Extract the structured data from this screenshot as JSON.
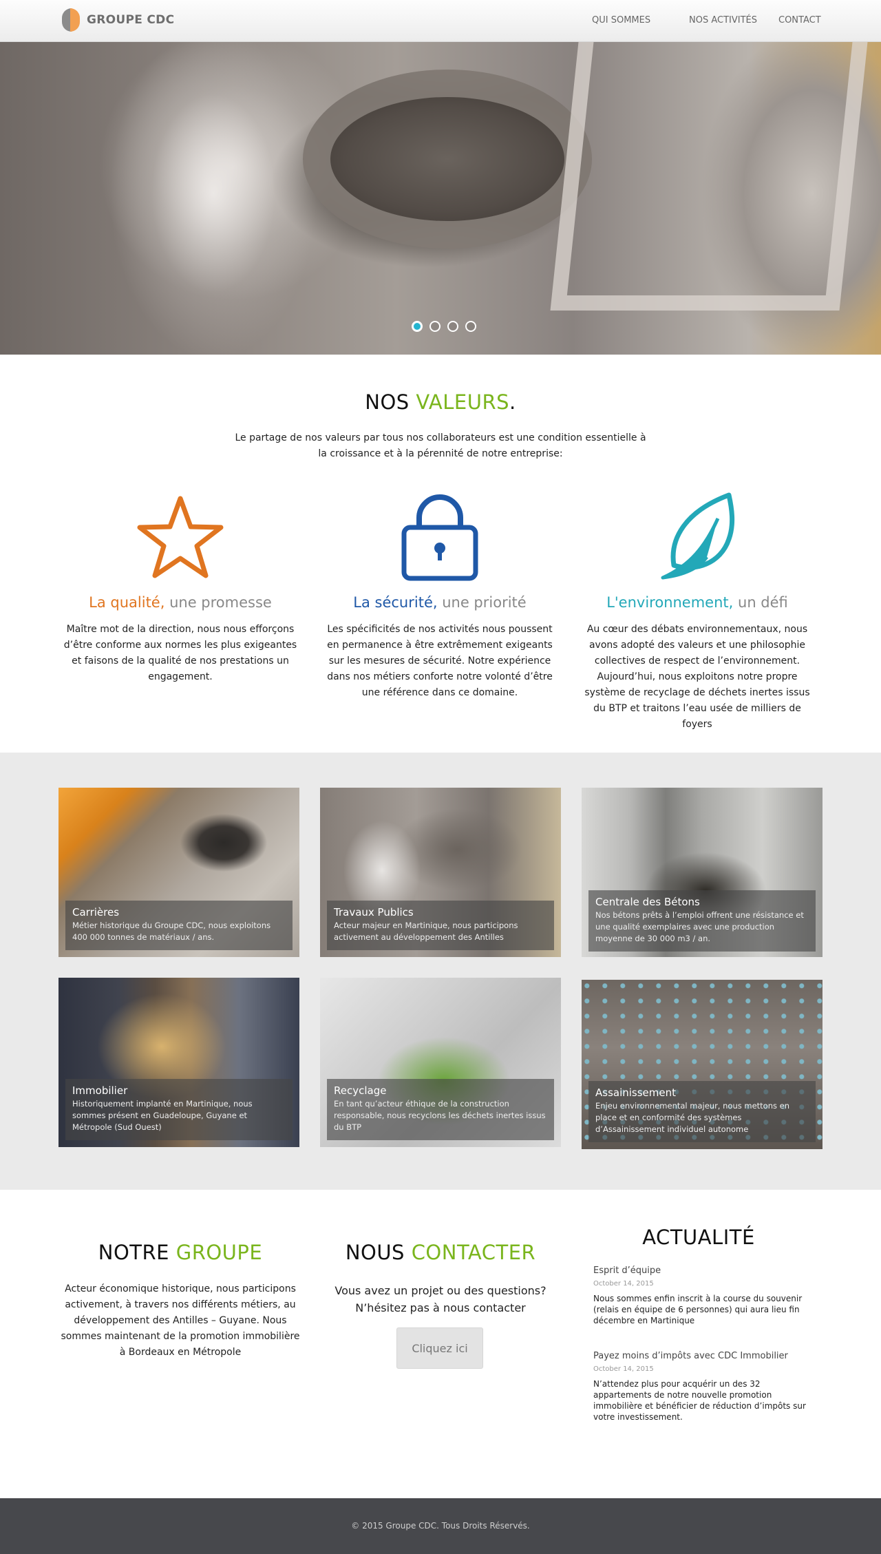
{
  "header": {
    "logo_text": "GROUPE CDC",
    "nav": [
      "QUI SOMMES",
      "NOS ACTIVITÉS",
      "CONTACT"
    ]
  },
  "hero": {
    "slides_count": 4,
    "active_slide": 1
  },
  "valeurs": {
    "title_main": "NOS ",
    "title_accent": "VALEURS",
    "title_end": ".",
    "intro": "Le partage de nos valeurs par tous nos collaborateurs est une condition essentielle à la croissance et à la pérennité de notre entreprise:",
    "items": [
      {
        "icon": "star-icon",
        "key": "La qualité,",
        "rest": " une promesse",
        "text": "Maître mot de la direction, nous nous efforçons d’être conforme aux normes les plus exigeantes et faisons de la qualité de nos prestations un engagement.",
        "color": "#e07520"
      },
      {
        "icon": "lock-icon",
        "key": "La sécurité,",
        "rest": " une priorité",
        "text": "Les spécificités de nos activités nous poussent en permanence à être extrêmement exigeants sur les mesures de sécurité. Notre expérience dans nos métiers conforte notre volonté d’être une référence dans ce domaine.",
        "color": "#1f58a7"
      },
      {
        "icon": "leaf-icon",
        "key": "L'environnement,",
        "rest": " un défi",
        "text": "Au cœur des débats environnementaux, nous avons adopté des valeurs et une philosophie collectives de respect de l’environnement. Aujourd’hui, nous exploitons notre propre système de recyclage de déchets inertes issus du BTP et traitons l’eau usée de milliers de foyers",
        "color": "#23a8b8"
      }
    ]
  },
  "activites": [
    {
      "title": "Carrières",
      "desc": "Métier historique du Groupe CDC, nous exploitons 400 000 tonnes de matériaux / ans."
    },
    {
      "title": "Travaux Publics",
      "desc": "Acteur majeur en Martinique, nous participons activement au développement des Antilles"
    },
    {
      "title": "Centrale des Bétons",
      "desc": "Nos bétons prêts à l’emploi offrent une résistance et une qualité exemplaires avec une production moyenne de 30 000 m3 / an."
    },
    {
      "title": "Immobilier",
      "desc": "Historiquement implanté en Martinique, nous sommes présent en Guadeloupe, Guyane et Métropole (Sud Ouest)"
    },
    {
      "title": "Recyclage",
      "desc": "En tant qu’acteur éthique de la construction responsable, nous recyclons les déchets inertes issus du BTP"
    },
    {
      "title": "Assainissement",
      "desc": "Enjeu environnemental majeur, nous mettons en place et en conformité des systèmes d’Assainissement individuel autonome"
    }
  ],
  "groupe": {
    "title_main": "NOTRE ",
    "title_accent": "GROUPE",
    "text": "Acteur économique historique, nous participons activement, à travers nos différents métiers, au développement des Antilles – Guyane. Nous sommes maintenant de la promotion immobilière à Bordeaux en Métropole"
  },
  "contact": {
    "title_main": "NOUS ",
    "title_accent": "CONTACTER",
    "line1": "Vous avez un projet ou des questions?",
    "line2": "N’hésitez pas à nous contacter",
    "button": "Cliquez ici"
  },
  "actualite": {
    "title": "ACTUALITÉ",
    "items": [
      {
        "title": "Esprit d’équipe",
        "date": "October 14, 2015",
        "text": "Nous sommes enfin inscrit à la course du souvenir (relais en équipe de 6 personnes) qui aura lieu fin décembre en Martinique"
      },
      {
        "title": "Payez moins d’impôts avec CDC Immobilier",
        "date": "October 14, 2015",
        "text": "N’attendez plus pour acquérir un des 32 appartements de notre nouvelle promotion immobilière et bénéficier de réduction d’impôts sur votre investissement."
      }
    ]
  },
  "footer": {
    "text": "© 2015 Groupe CDC. Tous Droits Réservés."
  },
  "colors": {
    "accent_green": "#7ab51d",
    "orange": "#e07520",
    "blue": "#1f58a7",
    "teal": "#23a8b8",
    "dot_active": "#23b4cf",
    "footer_bg": "#47484c"
  }
}
